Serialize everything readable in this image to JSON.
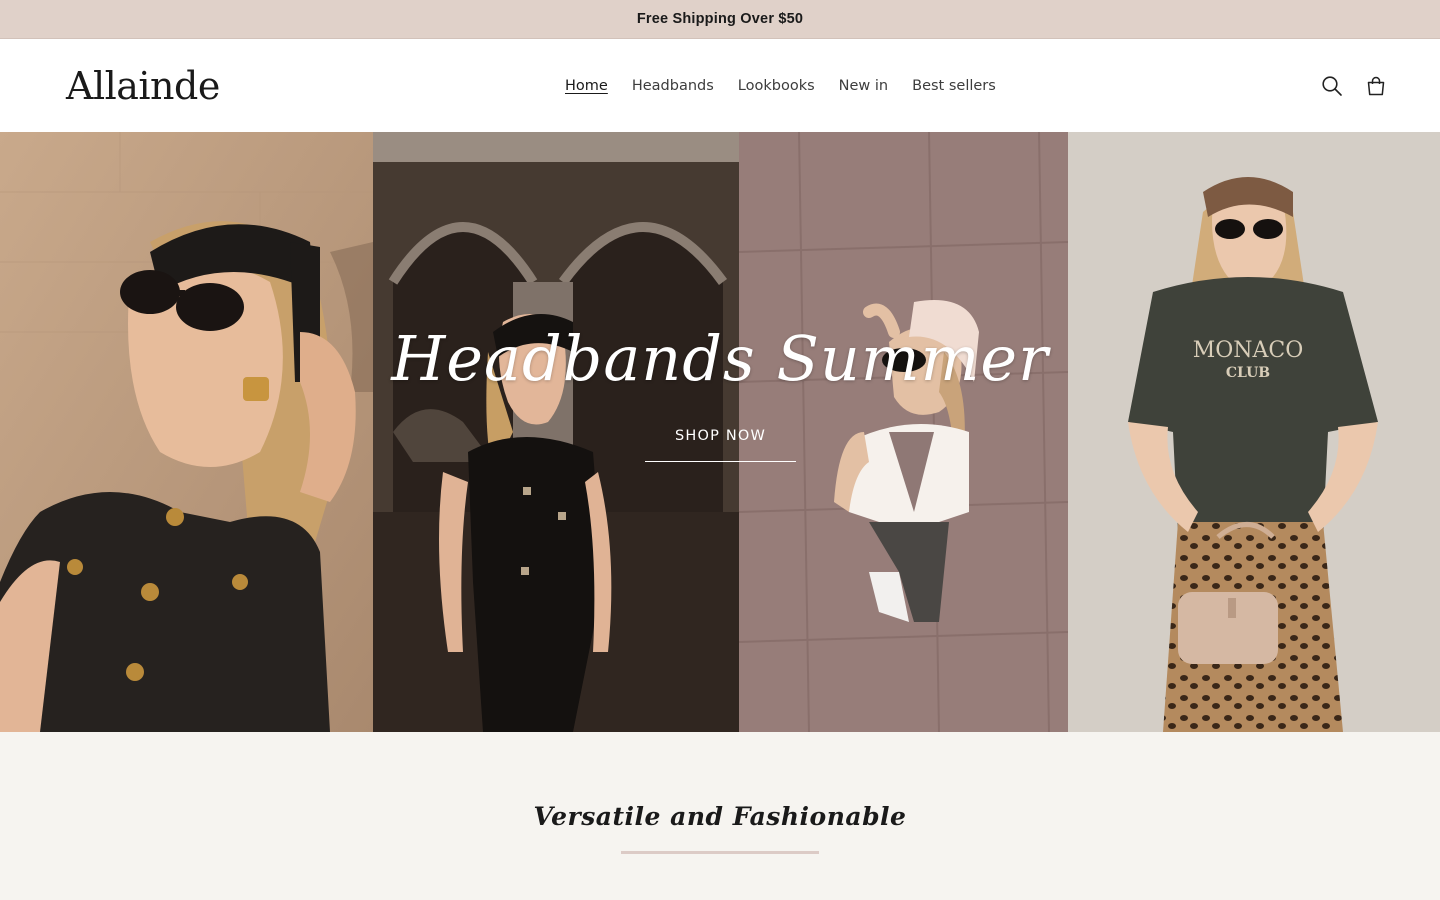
{
  "announcement": {
    "text": "Free Shipping Over $50"
  },
  "header": {
    "logo": "Allainde",
    "nav": [
      {
        "label": "Home",
        "active": true
      },
      {
        "label": "Headbands",
        "active": false
      },
      {
        "label": "Lookbooks",
        "active": false
      },
      {
        "label": "New in",
        "active": false
      },
      {
        "label": "Best sellers",
        "active": false
      }
    ],
    "icons": [
      "search-icon",
      "cart-icon"
    ]
  },
  "hero": {
    "title": "Headbands Summer",
    "cta": "SHOP NOW",
    "panels": [
      "model-black-headband-closeup",
      "model-black-vest-arches",
      "model-white-headband-overhead",
      "model-monaco-tee-leopard-skirt"
    ],
    "shirt_text": {
      "line1": "MONACO",
      "line2": "CLUB"
    }
  },
  "section": {
    "title": "Versatile and Fashionable"
  },
  "colors": {
    "announcement_bg": "#e0d1c9",
    "section_bg": "#f6f4f0",
    "rule": "#dccbc6"
  }
}
